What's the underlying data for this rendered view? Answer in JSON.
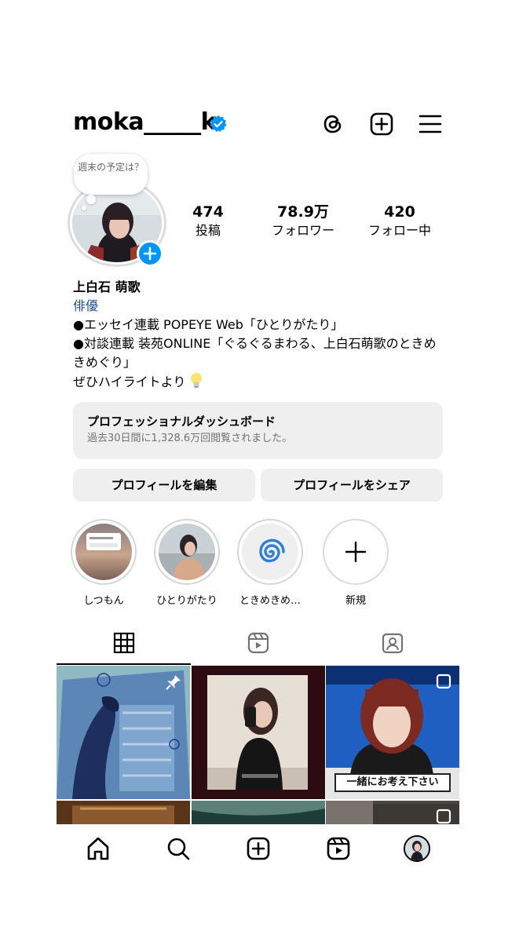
{
  "header": {
    "username": "moka_____k",
    "icons": [
      "threads-icon",
      "create-post-icon",
      "menu-icon"
    ]
  },
  "note": {
    "text": "週末の予定は？"
  },
  "stats": {
    "posts": {
      "value": "474",
      "label": "投稿"
    },
    "followers": {
      "value": "78.9万",
      "label": "フォロワー"
    },
    "following": {
      "value": "420",
      "label": "フォロー中"
    }
  },
  "bio": {
    "name": "上白石 萌歌",
    "category": "俳優",
    "line1": "●エッセイ連載 POPEYE Web「ひとりがたり」",
    "line2": "●対談連載 装苑ONLINE「ぐるぐるまわる、上白石萌歌のときめきめぐり」",
    "line3": "ぜひハイライトより"
  },
  "dashboard": {
    "title": "プロフェッショナルダッシュボード",
    "subtitle": "過去30日間に1,328.6万回閲覧されました。"
  },
  "buttons": {
    "edit": "プロフィールを編集",
    "share": "プロフィールをシェア"
  },
  "highlights": [
    {
      "label": "しつもん"
    },
    {
      "label": "ひとりがたり"
    },
    {
      "label": "ときめきめ…"
    },
    {
      "label": "新規"
    }
  ],
  "tabs": [
    "grid-icon",
    "reels-icon",
    "tagged-icon"
  ],
  "colors": {
    "accent": "#0095f6",
    "button_bg": "#efefef",
    "category": "#1f4f86"
  },
  "grid_tile_texts": {
    "tile3_caption": "一緒にお考え下さい"
  },
  "bottom_nav": [
    "home-icon",
    "search-icon",
    "create-icon",
    "reels-icon",
    "profile-avatar"
  ]
}
